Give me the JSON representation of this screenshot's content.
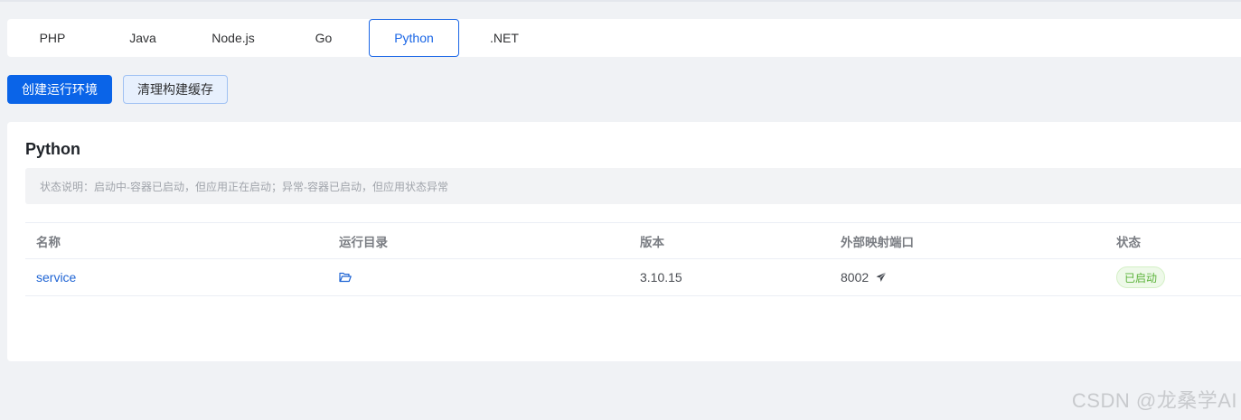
{
  "tabs": [
    {
      "label": "PHP"
    },
    {
      "label": "Java"
    },
    {
      "label": "Node.js"
    },
    {
      "label": "Go"
    },
    {
      "label": "Python",
      "active": true
    },
    {
      "label": ".NET"
    }
  ],
  "actions": {
    "create_label": "创建运行环境",
    "clear_cache_label": "清理构建缓存"
  },
  "panel": {
    "title": "Python",
    "notice": "状态说明：启动中-容器已启动，但应用正在启动；异常-容器已启动，但应用状态异常"
  },
  "table": {
    "columns": [
      "名称",
      "运行目录",
      "版本",
      "外部映射端口",
      "状态"
    ],
    "rows": [
      {
        "name": "service",
        "dir_icon": "folder-open-icon",
        "version": "3.10.15",
        "port": "8002",
        "port_icon": "send-icon",
        "status": "已启动"
      }
    ]
  },
  "colors": {
    "primary": "#0a64e8",
    "status_success": "#5bb33a"
  },
  "watermark": "CSDN @龙桑学AI"
}
